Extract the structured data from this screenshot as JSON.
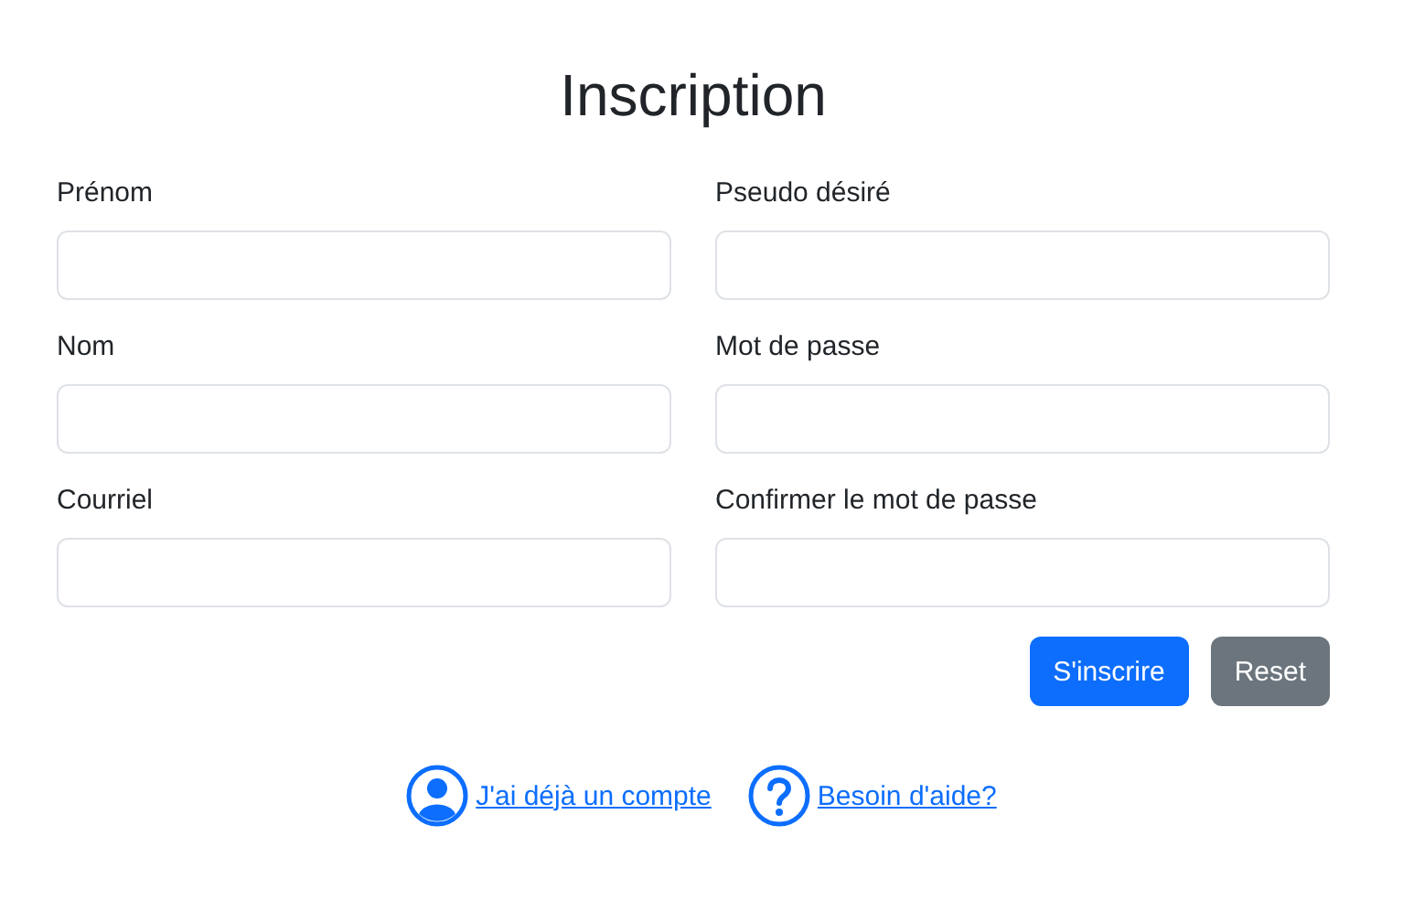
{
  "title": "Inscription",
  "fields": [
    {
      "label": "Prénom"
    },
    {
      "label": "Pseudo désiré"
    },
    {
      "label": "Nom"
    },
    {
      "label": "Mot de passe"
    },
    {
      "label": "Courriel"
    },
    {
      "label": "Confirmer le mot de passe"
    }
  ],
  "buttons": [
    {
      "label": "S'inscrire",
      "kind": "primary"
    },
    {
      "label": "Reset",
      "kind": "secondary"
    }
  ],
  "links": [
    {
      "label": "J'ai déjà un compte",
      "kind": "account"
    },
    {
      "label": "Besoin d'aide?",
      "kind": "help"
    }
  ]
}
